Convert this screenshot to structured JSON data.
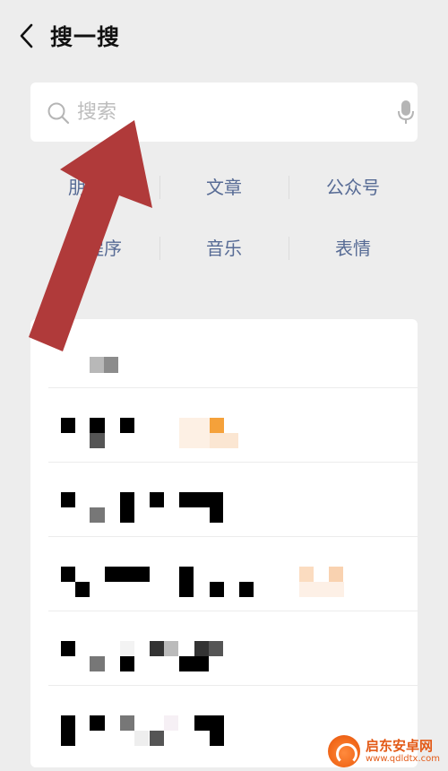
{
  "header": {
    "back_icon": "chevron-left-icon",
    "title": "搜一搜"
  },
  "search": {
    "placeholder": "搜索",
    "value": "",
    "search_icon": "search-icon",
    "mic_icon": "microphone-icon"
  },
  "categories": {
    "row1": [
      {
        "label": "朋友圈"
      },
      {
        "label": "文章"
      },
      {
        "label": "公众号"
      }
    ],
    "row2": [
      {
        "label": "小程序"
      },
      {
        "label": "音乐"
      },
      {
        "label": "表情"
      }
    ]
  },
  "annotation": {
    "arrow_icon": "red-arrow-icon",
    "color": "#b03a3a"
  },
  "watermark": {
    "name": "启东安卓网",
    "url": "www.qdldtx.com",
    "logo_icon": "qidong-logo-icon"
  },
  "colors": {
    "background": "#ededed",
    "link": "#576b95",
    "accent_orange": "#f5a13a"
  }
}
